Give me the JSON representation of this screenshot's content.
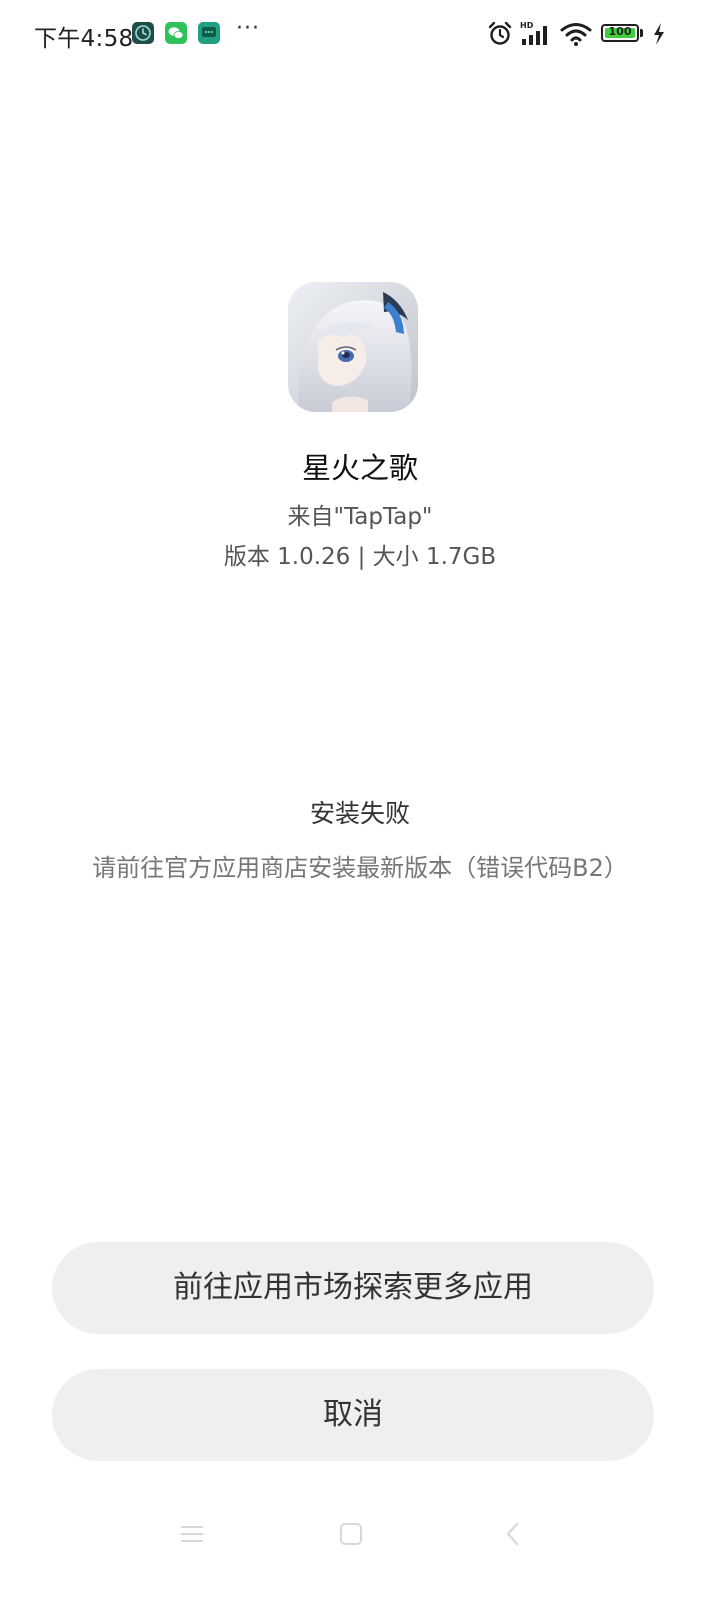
{
  "status_bar": {
    "time": "下午4:58",
    "more": "···",
    "battery_level": "100",
    "notification_icons": [
      "clock-app-icon",
      "wechat-icon",
      "message-icon"
    ],
    "system_icons": [
      "alarm-icon",
      "hd-signal-icon",
      "wifi-icon",
      "battery-icon",
      "charging-icon"
    ],
    "battery_color": "#3fcf3a"
  },
  "app": {
    "name": "星火之歌",
    "source": "来自\"TapTap\"",
    "version_info": "版本 1.0.26 | 大小 1.7GB",
    "icon": "anime-character-app-icon"
  },
  "install": {
    "status": "安装失败",
    "error_message": "请前往官方应用商店安装最新版本（错误代码B2）"
  },
  "buttons": {
    "market_label": "前往应用市场探索更多应用",
    "cancel_label": "取消",
    "background": "#efefef"
  },
  "nav_bar": {
    "icons": [
      "menu-icon",
      "home-icon",
      "back-icon"
    ]
  }
}
